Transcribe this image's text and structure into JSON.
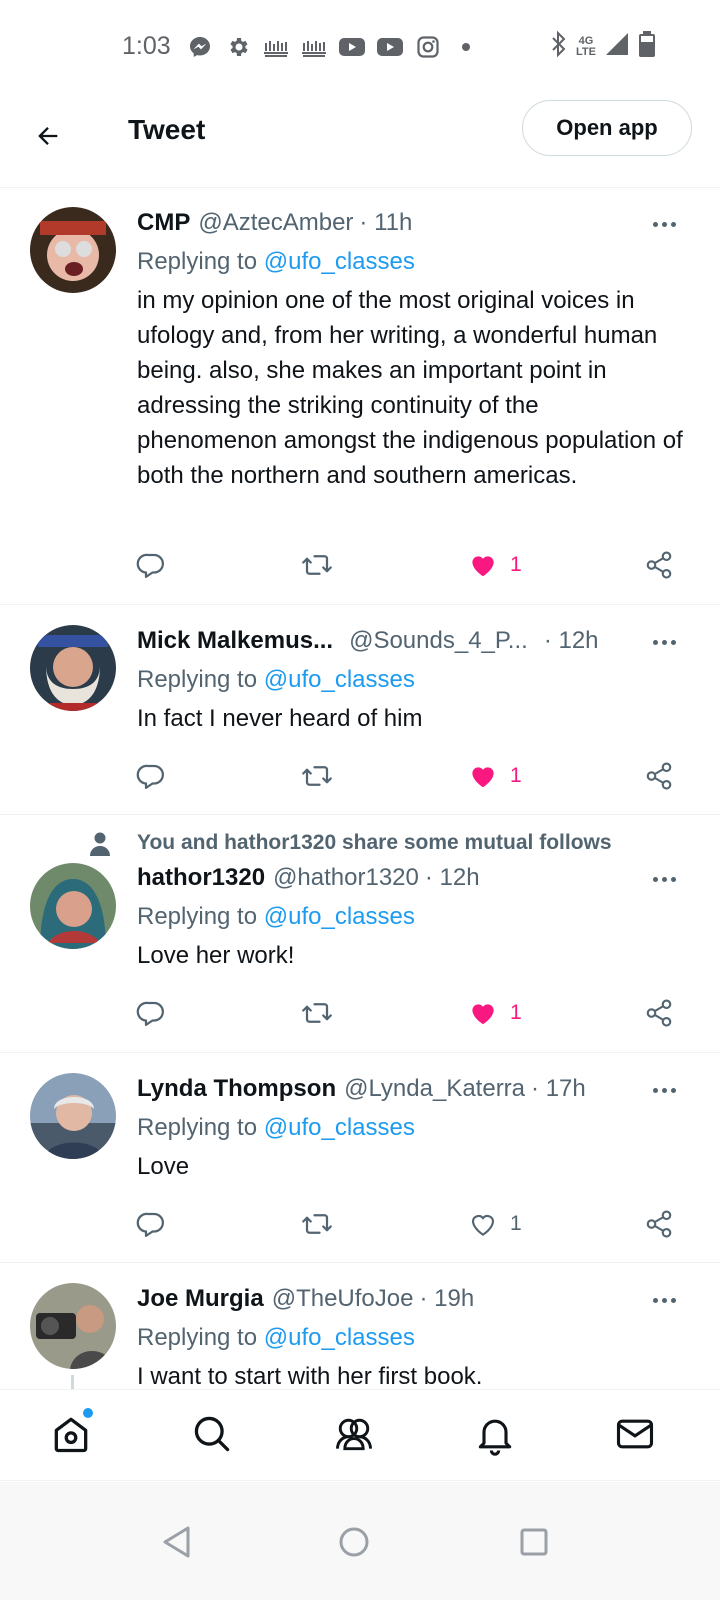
{
  "status_bar": {
    "time": "1:03",
    "network": "4G",
    "network_sub": "LTE",
    "left_icons": [
      "messenger-icon",
      "settings-icon",
      "app-icon",
      "app-icon",
      "youtube-icon",
      "youtube-icon",
      "instagram-icon",
      "dot-icon"
    ],
    "right_icons": [
      "bluetooth-icon",
      "signal-icon",
      "battery-icon"
    ]
  },
  "header": {
    "title": "Tweet",
    "open_app_label": "Open app"
  },
  "tweets": [
    {
      "name": "CMP",
      "handle": "@AztecAmber",
      "time": "· 11h",
      "replying_prefix": "Replying to ",
      "replying_to": "@ufo_classes",
      "text": "in my opinion one of the most original voices in ufology and, from her writing, a wonderful human being. also, she makes an important point in adressing the striking continuity of the phenomenon amongst the indigenous population of both the northern and southern americas.",
      "likes": "1",
      "liked": true
    },
    {
      "name": "Mick Malkemus...",
      "handle": "@Sounds_4_P...",
      "time": "· 12h",
      "replying_prefix": "Replying to ",
      "replying_to": "@ufo_classes",
      "text": "In fact I never heard of him",
      "likes": "1",
      "liked": true
    },
    {
      "social_context": "You and hathor1320 share some mutual follows",
      "name": "hathor1320",
      "handle": "@hathor1320",
      "time": "· 12h",
      "replying_prefix": "Replying to ",
      "replying_to": "@ufo_classes",
      "text": "Love her work!",
      "likes": "1",
      "liked": true
    },
    {
      "name": "Lynda Thompson",
      "handle": "@Lynda_Katerra",
      "time": "· 17h",
      "replying_prefix": "Replying to ",
      "replying_to": "@ufo_classes",
      "text": "Love",
      "likes": "1",
      "liked": false
    },
    {
      "name": "Joe Murgia",
      "handle": "@TheUfoJoe",
      "time": "· 19h",
      "replying_prefix": "Replying to ",
      "replying_to": "@ufo_classes",
      "text": "I want to start with her first book."
    }
  ],
  "bottom_nav": {
    "items": [
      "home-icon",
      "search-icon",
      "communities-icon",
      "notifications-icon",
      "messages-icon"
    ],
    "home_has_new": true
  },
  "colors": {
    "accent": "#1d9bf0",
    "like": "#f91880",
    "secondary_text": "#536471",
    "primary_text": "#0f1419"
  }
}
